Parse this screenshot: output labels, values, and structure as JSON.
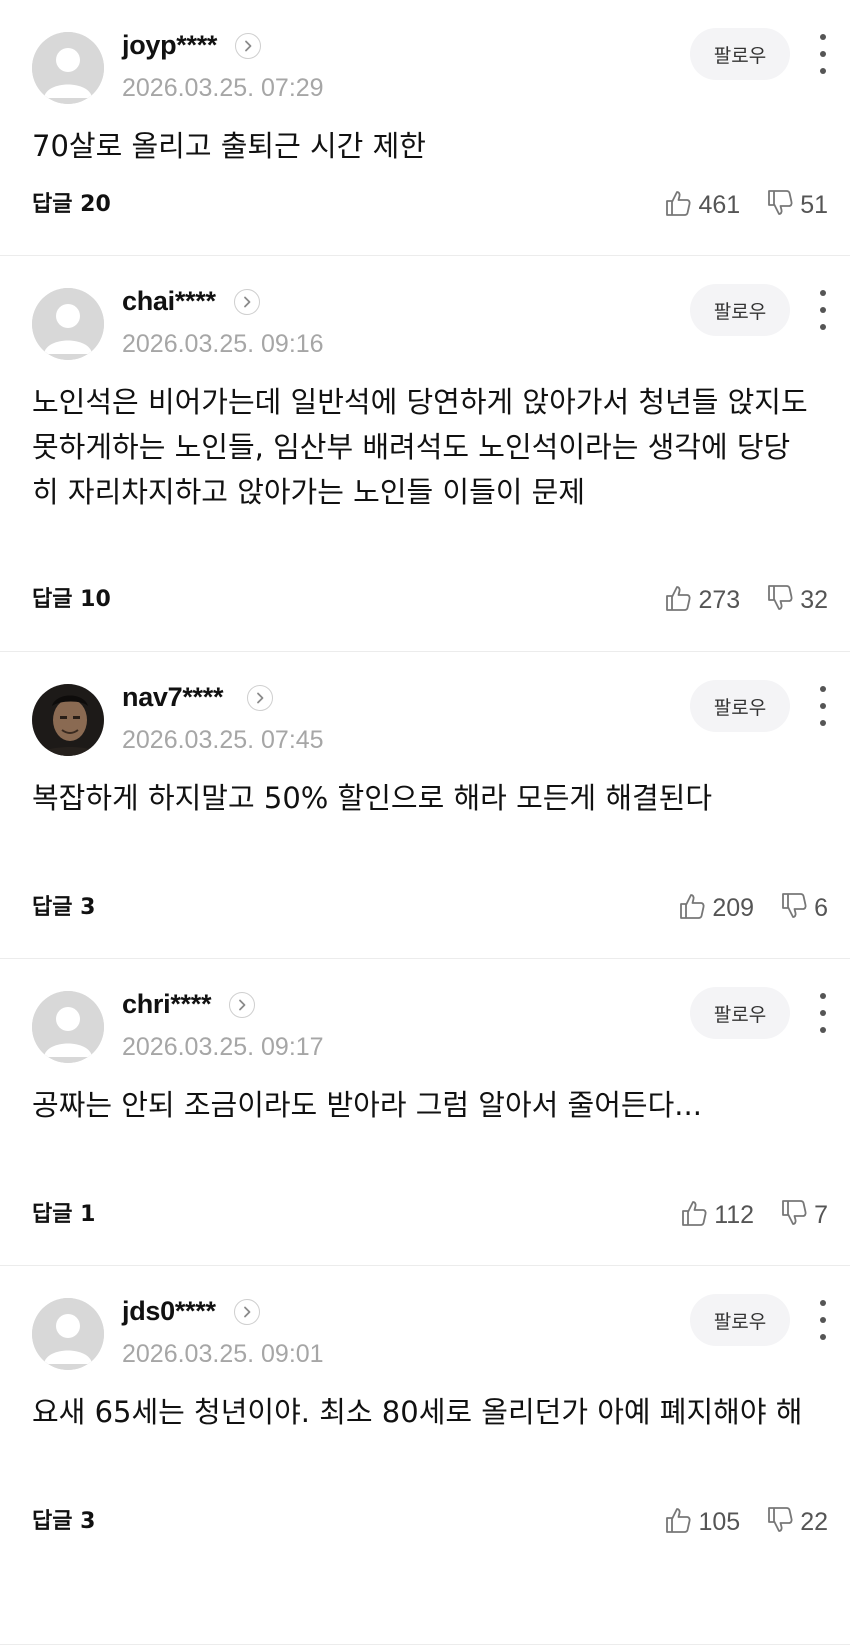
{
  "follow_label": "팔로우",
  "comments": [
    {
      "author": "joyp****",
      "date": "2026.03.25. 07:29",
      "text": "70살로 올리고 출퇴근 시간 제한",
      "reply_label": "답글 20",
      "likes": "461",
      "dislikes": "51",
      "avatar": "default"
    },
    {
      "author": "chai****",
      "date": "2026.03.25. 09:16",
      "text": "노인석은 비어가는데 일반석에 당연하게 앉아가서 청년들 앉지도 못하게하는 노인들, 임산부 배려석도 노인석이라는 생각에 당당히 자리차지하고 앉아가는 노인들 이들이 문제",
      "reply_label": "답글 10",
      "likes": "273",
      "dislikes": "32",
      "avatar": "default"
    },
    {
      "author": "nav7****",
      "date": "2026.03.25. 07:45",
      "text": "복잡하게 하지말고 50% 할인으로 해라 모든게 해결된다",
      "reply_label": "답글 3",
      "likes": "209",
      "dislikes": "6",
      "avatar": "photo"
    },
    {
      "author": "chri****",
      "date": "2026.03.25. 09:17",
      "text": "공짜는 안되 조금이라도 받아라 그럼 알아서 줄어든다...",
      "reply_label": "답글 1",
      "likes": "112",
      "dislikes": "7",
      "avatar": "default"
    },
    {
      "author": "jds0****",
      "date": "2026.03.25. 09:01",
      "text": "요새 65세는 청년이야. 최소 80세로 올리던가 아예 폐지해야 해",
      "reply_label": "답글 3",
      "likes": "105",
      "dislikes": "22",
      "avatar": "default"
    }
  ]
}
